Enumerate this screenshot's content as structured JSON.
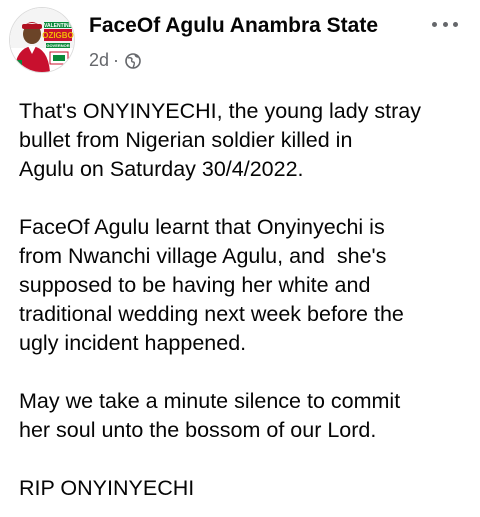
{
  "post": {
    "author": "FaceOf Agulu Anambra State",
    "time": "2d",
    "separator": "·",
    "paragraphs": [
      {
        "lines": [
          "That's ONYINYECHI, the young lady stray",
          "bullet from Nigerian soldier killed in",
          "Agulu on Saturday 30/4/2022."
        ]
      },
      {
        "lines": [
          "FaceOf Agulu learnt that Onyinyechi is",
          "from Nwanchi village Agulu, and  she's",
          "supposed to be having her white and",
          "traditional wedding next week before the",
          "ugly incident happened."
        ]
      },
      {
        "lines": [
          "May we take a minute silence to commit",
          "her soul unto the bossom of our Lord."
        ]
      },
      {
        "lines": [
          "RIP ONYINYECHI"
        ]
      }
    ]
  },
  "avatar": {
    "text_top": "VALENTINE",
    "text_main": "OZIGBO",
    "text_sub": "GOVERNOR",
    "colors": {
      "red": "#c8102e",
      "green": "#0a8a3a",
      "gold": "#f2b705",
      "skin": "#6b4428",
      "cap": "#b01020",
      "white": "#ffffff"
    }
  },
  "icons": {
    "privacy": "globe-icon",
    "menu": "more-horizontal-icon"
  },
  "colors": {
    "text": "#050505",
    "secondary": "#65676b",
    "background": "#ffffff"
  }
}
